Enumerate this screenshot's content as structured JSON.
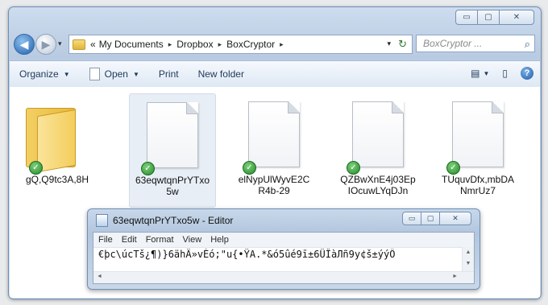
{
  "explorer": {
    "window_controls": {
      "minimize": "▭",
      "maximize": "▢",
      "close": "✕"
    },
    "nav": {
      "back": "◀",
      "forward": "▶",
      "history_dropdown": "▾"
    },
    "breadcrumb": {
      "overflow": "«",
      "items": [
        "My Documents",
        "Dropbox",
        "BoxCryptor"
      ],
      "separator": "▸",
      "dropdown": "▾",
      "refresh": "↻"
    },
    "search": {
      "placeholder": "BoxCryptor ...",
      "icon": "search-icon"
    },
    "toolbar": {
      "organize": "Organize",
      "open": "Open",
      "print": "Print",
      "new_folder": "New folder",
      "dropdown_arrow": "▼",
      "views_icon": "▤",
      "preview_icon": "▯",
      "help": "?"
    },
    "items": [
      {
        "name": "gQ,Q9tc3A,8H",
        "type": "folder",
        "selected": false
      },
      {
        "name": "63eqwtqnPrYTxo5w",
        "type": "file",
        "selected": true
      },
      {
        "name": "elNypUlWyvE2CR4b-29",
        "type": "file",
        "selected": false
      },
      {
        "name": "QZBwXnE4j03EpIOcuwLYqDJn",
        "type": "file",
        "selected": false
      },
      {
        "name": "TUquvDfx,mbDANmrUz7",
        "type": "file",
        "selected": false
      }
    ],
    "sync_badge": "✓"
  },
  "editor": {
    "title": "63eqwtqnPrYTxo5w - Editor",
    "menu": [
      "File",
      "Edit",
      "Format",
      "View",
      "Help"
    ],
    "content": "€þc\\úcTš¿¶)}6ähÄ»vÉó;\"u{•ŸA.*&ó5ûé9ī±6ÜÎàЛñ9y¢š±ýýÔ",
    "scroll": {
      "up": "▲",
      "down": "▼",
      "left": "◄",
      "right": "►"
    }
  }
}
